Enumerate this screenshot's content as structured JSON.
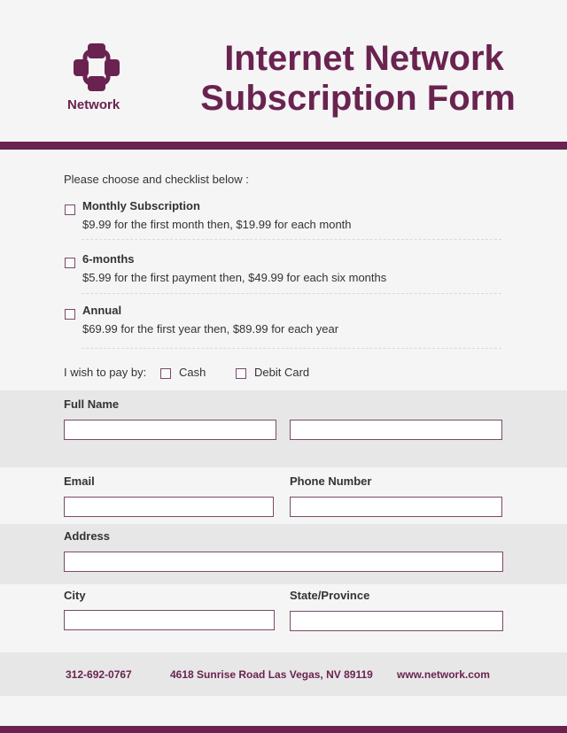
{
  "brand": {
    "logo_icon": "network-nodes-icon",
    "name": "Network",
    "color": "#6a2350"
  },
  "header": {
    "title_line1": "Internet Network",
    "title_line2": "Subscription Form"
  },
  "subscription": {
    "intro": "Please choose and checklist below :",
    "options": [
      {
        "title": "Monthly Subscription",
        "description": "$9.99 for the first month then, $19.99 for each month",
        "checked": false
      },
      {
        "title": "6-months",
        "description": "$5.99 for the first payment then, $49.99 for each six months",
        "checked": false
      },
      {
        "title": "Annual",
        "description": "$69.99 for the first year then, $89.99 for each year",
        "checked": false
      }
    ]
  },
  "payment": {
    "label": "I wish to pay by:",
    "methods": [
      {
        "label": "Cash",
        "checked": false
      },
      {
        "label": "Debit Card",
        "checked": false
      }
    ]
  },
  "form": {
    "full_name": {
      "label": "Full Name",
      "first_value": "",
      "last_value": ""
    },
    "email": {
      "label": "Email",
      "value": ""
    },
    "phone": {
      "label": "Phone Number",
      "value": ""
    },
    "address": {
      "label": "Address",
      "value": ""
    },
    "city": {
      "label": "City",
      "value": ""
    },
    "state": {
      "label": "State/Province",
      "value": ""
    }
  },
  "footer": {
    "phone": "312-692-0767",
    "address": "4618 Sunrise Road Las Vegas, NV 89119",
    "website": "www.network.com"
  }
}
